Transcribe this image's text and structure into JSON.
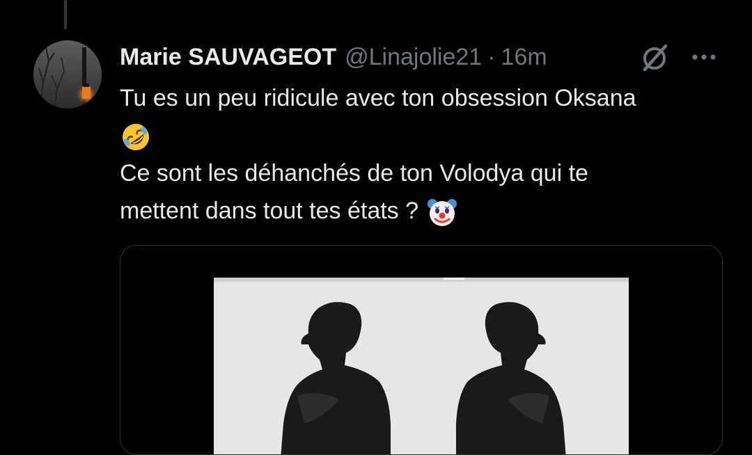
{
  "tweet": {
    "author": {
      "display_name": "Marie SAUVAGEOT",
      "handle": "@Linajolie21",
      "separator": "·",
      "timestamp": "16m"
    },
    "text": {
      "line1": "Tu es un peu ridicule avec ton obsession Oksana",
      "emoji1": "rolling-on-floor-laughing",
      "line2": "Ce sont les déhanchés de ton Volodya qui te",
      "line3": "mettent dans tout tes états ?",
      "emoji2": "clown-face"
    },
    "media": {
      "type": "image",
      "description_icon": "silhouettes-image"
    },
    "actions": {
      "grok_icon": "grok-icon",
      "more_icon": "more-horizontal-icon"
    }
  },
  "colors": {
    "background": "#000000",
    "primary_text": "#e7e9ea",
    "secondary_text": "#71767b",
    "border": "#2f3336"
  }
}
